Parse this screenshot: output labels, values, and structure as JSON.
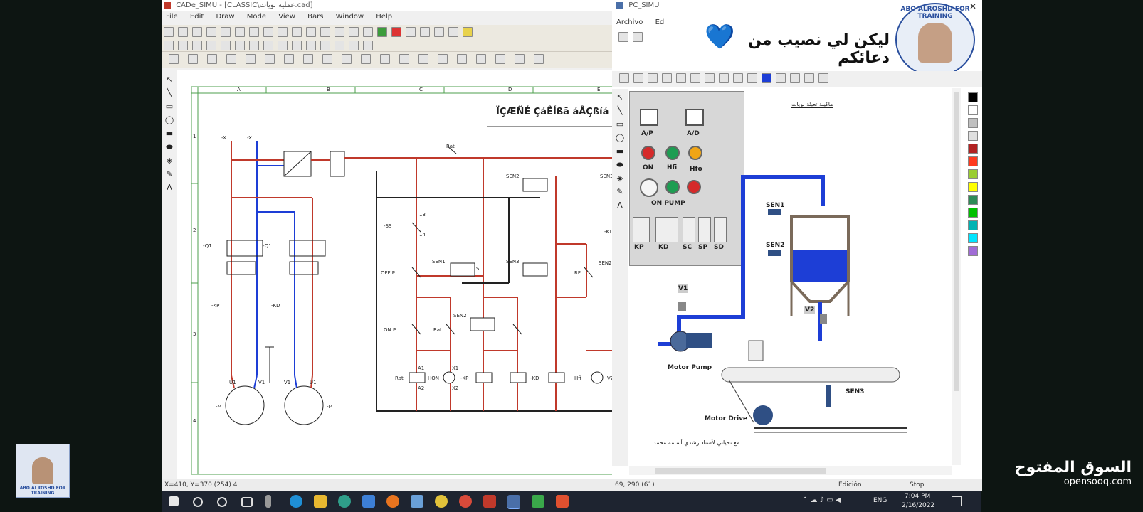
{
  "cade": {
    "title": "CADe_SIMU - [CLASSIC\\عملية بويات.cad]",
    "menu": [
      "File",
      "Edit",
      "Draw",
      "Mode",
      "View",
      "Bars",
      "Window",
      "Help"
    ],
    "drawing_title": "ÏÇÆÑÉ ÇáÊÍßã áÂÇßíá",
    "columns": [
      "A",
      "B",
      "C",
      "D",
      "E"
    ],
    "rows": [
      "1",
      "2",
      "3",
      "4"
    ],
    "status": "X=410, Y=370 (254) 4",
    "labels": {
      "supply": [
        "-X",
        "-X"
      ],
      "q1_left": "-Q1",
      "q1_right": "-Q1",
      "kp": "-KP",
      "kd": "-KD",
      "m_left": "-M",
      "m_right": "-M",
      "u1": "U1",
      "v1": "V1",
      "ss": "-SS",
      "off": "OFF P",
      "on": "ON P",
      "rat": "Rat",
      "sen1": "SEN1",
      "sen2": "SEN2",
      "sen3": "SEN3",
      "kt": "-KT",
      "rf": "RF",
      "hfi": "Hfi",
      "kp_coil": "-KP",
      "kd_coil": "-KD",
      "hon": "HON",
      "v2": "V2",
      "n13": "13",
      "n14": "14",
      "a1": "A1",
      "a2": "A2",
      "x1": "X1",
      "x2": "X2",
      "rat_top": "Rat",
      "s": "S"
    }
  },
  "pcsimu": {
    "title": "PC_SIMU",
    "menu": [
      "Archivo",
      "Ed"
    ],
    "banner": "ليكن لي نصيب من دعائكم",
    "heart": "💙",
    "logo_text": "ABO ALROSHD FOR TRAINING",
    "scene_title": "ماكينة تعبئة بويات",
    "panel": {
      "meters": [
        "A/P",
        "A/D"
      ],
      "buttons": [
        "ON",
        "Hfi",
        "Hfo"
      ],
      "on_pump": "ON PUMP",
      "modules": [
        "KP",
        "KD",
        "SC",
        "SP",
        "SD"
      ]
    },
    "sensors": [
      "SEN1",
      "SEN2",
      "SEN3"
    ],
    "valves": [
      "V1",
      "V2"
    ],
    "motor_pump": "Motor Pump",
    "motor_drive": "Motor Drive",
    "footer_note": "مع تحياتي لأستاذ رشدي أسامة محمد",
    "status": [
      "69, 290 (61)",
      "Edición",
      "Stop"
    ],
    "palette": [
      "#000000",
      "#ffffff",
      "#c0c0c0",
      "#e0e0e0",
      "#b22222",
      "#ff3b1f",
      "#9acd32",
      "#ffff00",
      "#2e8b57",
      "#00c000",
      "#00b3b3",
      "#00e5ff",
      "#a06cd5"
    ]
  },
  "taskbar": {
    "time": "7:04 PM",
    "date": "2/16/2022",
    "lang": "ENG"
  },
  "watermark": {
    "arabic": "السوق المفتوح",
    "latin": "opensooq.com"
  },
  "corner_logo_text": "ABO ALROSHD FOR TRAINING"
}
